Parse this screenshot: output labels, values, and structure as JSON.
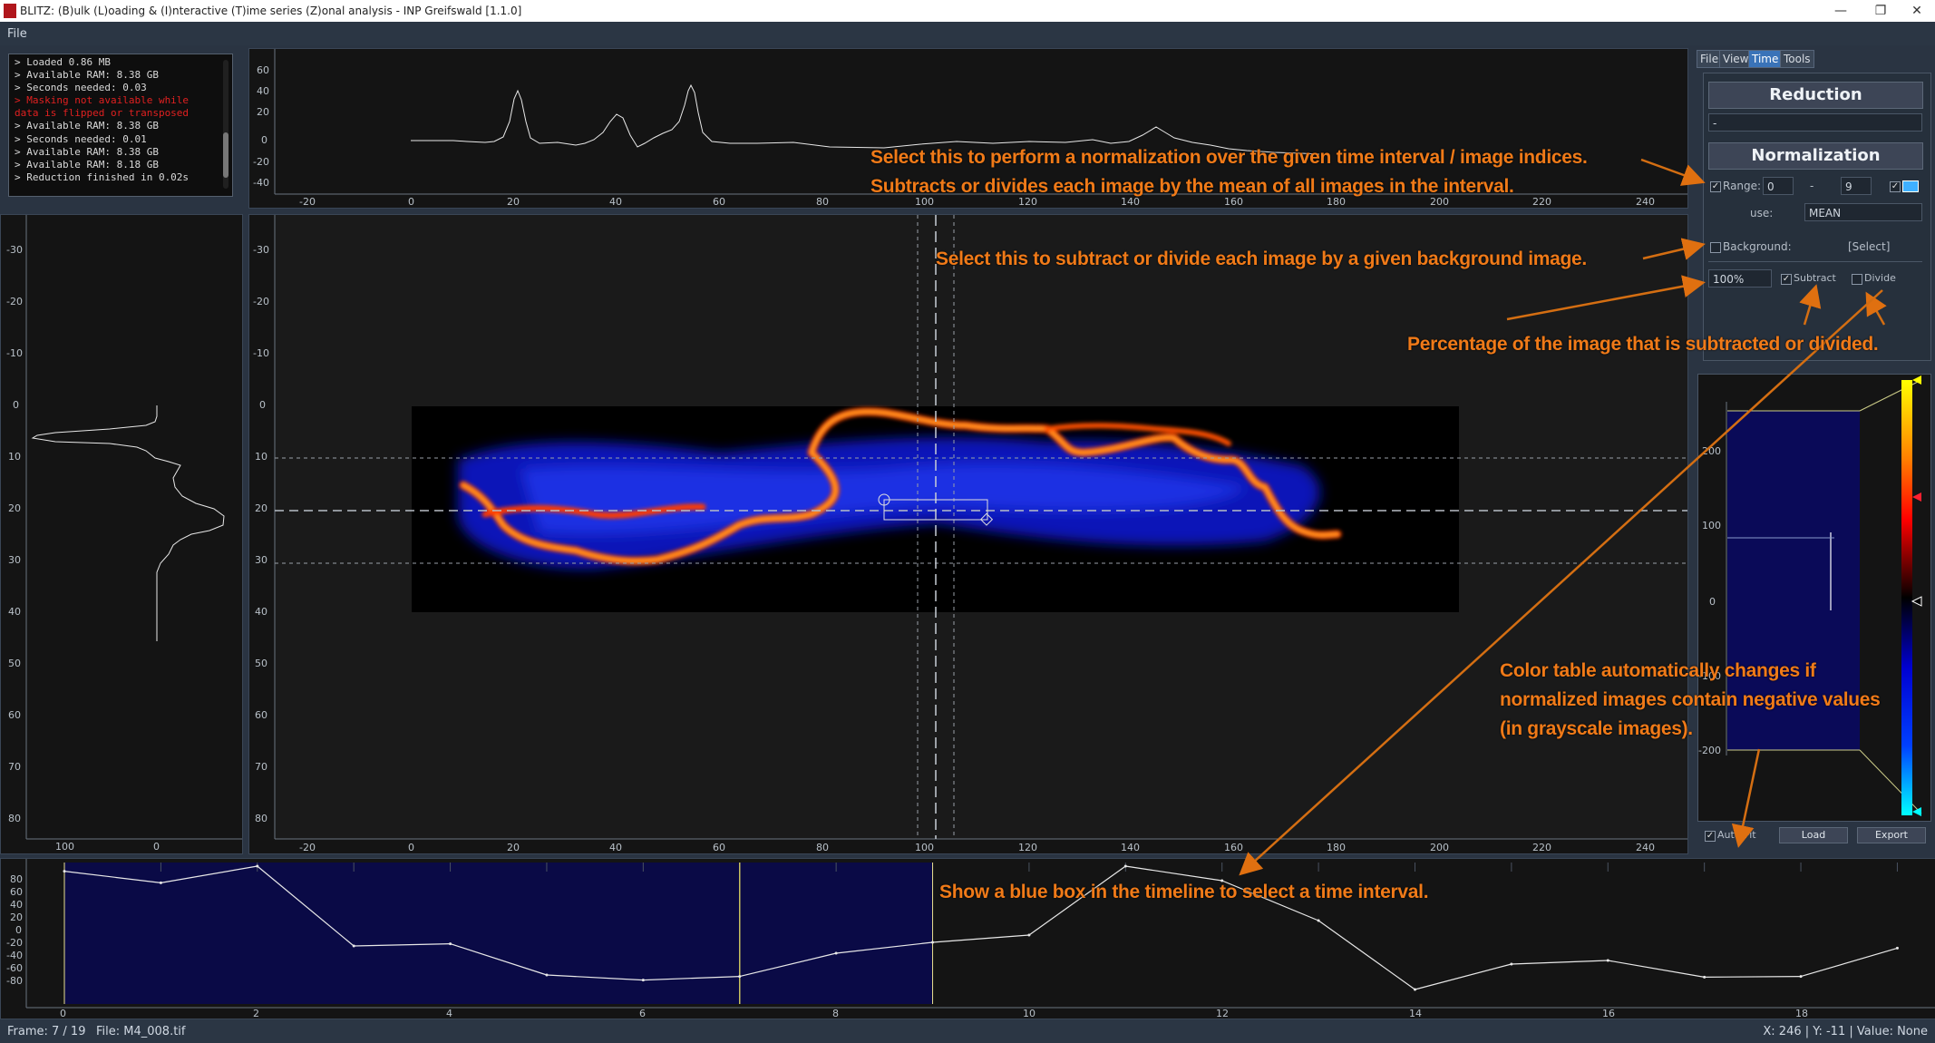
{
  "window": {
    "title": "BLITZ: (B)ulk (L)oading & (I)nteractive (T)ime series (Z)onal analysis - INP Greifswald [1.1.0]",
    "minimize_glyph": "—",
    "maximize_glyph": "❐",
    "close_glyph": "✕"
  },
  "menu": {
    "file": "File"
  },
  "console": {
    "lines": [
      {
        "text": "> Loaded 0.86 MB",
        "kind": "normal"
      },
      {
        "text": "> Available RAM: 8.38 GB",
        "kind": "normal"
      },
      {
        "text": "> Seconds needed: 0.03",
        "kind": "normal"
      },
      {
        "text": "> Masking not available while",
        "kind": "error"
      },
      {
        "text": "data is flipped or transposed",
        "kind": "error"
      },
      {
        "text": "> Available RAM: 8.38 GB",
        "kind": "normal"
      },
      {
        "text": "> Seconds needed: 0.01",
        "kind": "normal"
      },
      {
        "text": "> Available RAM: 8.38 GB",
        "kind": "normal"
      },
      {
        "text": "> Available RAM: 8.18 GB",
        "kind": "normal"
      },
      {
        "text": "> Reduction finished in 0.02s",
        "kind": "normal"
      }
    ]
  },
  "top_plot": {
    "y_ticks": [
      "60",
      "40",
      "20",
      "0",
      "-20",
      "-40"
    ],
    "x_ticks": [
      "-20",
      "0",
      "20",
      "40",
      "60",
      "80",
      "100",
      "120",
      "140",
      "160",
      "180",
      "200",
      "220",
      "240"
    ]
  },
  "left_plot": {
    "y_ticks": [
      "-30",
      "-20",
      "-10",
      "0",
      "10",
      "20",
      "30",
      "40",
      "50",
      "60",
      "70",
      "80"
    ],
    "x_ticks": [
      "100",
      "0"
    ]
  },
  "main_view": {
    "y_ticks": [
      "-30",
      "-20",
      "-10",
      "0",
      "10",
      "20",
      "30",
      "40",
      "50",
      "60",
      "70",
      "80"
    ],
    "x_ticks": [
      "-20",
      "0",
      "20",
      "40",
      "60",
      "80",
      "100",
      "120",
      "140",
      "160",
      "180",
      "200",
      "220",
      "240"
    ]
  },
  "tabs": [
    {
      "label": "File",
      "active": false
    },
    {
      "label": "View",
      "active": false
    },
    {
      "label": "Time",
      "active": true
    },
    {
      "label": "Tools",
      "active": false
    }
  ],
  "time_panel": {
    "reduction_label": "Reduction",
    "reduction_value": "-",
    "normalization_label": "Normalization",
    "range_label": "Range:",
    "range_start": "0",
    "range_sep": "-",
    "range_end": "9",
    "use_label": "use:",
    "use_value": "MEAN",
    "background_label": "Background:",
    "select_label": "[Select]",
    "percent_value": "100%",
    "subtract_label": "Subtract",
    "subtract_checked": true,
    "divide_label": "Divide",
    "divide_checked": false,
    "range_checked": true,
    "timeline_box_checked": true
  },
  "lut": {
    "y_ticks": [
      "200",
      "100",
      "0",
      "-100",
      "-200"
    ],
    "autofit_label": "Auto-Fit",
    "autofit_checked": true,
    "load_label": "Load",
    "export_label": "Export"
  },
  "timeline": {
    "y_ticks": [
      "80",
      "60",
      "40",
      "20",
      "0",
      "-20",
      "-40",
      "-60",
      "-80"
    ],
    "x_ticks": [
      "0",
      "2",
      "4",
      "6",
      "8",
      "10",
      "12",
      "14",
      "16",
      "18"
    ]
  },
  "chart_data": {
    "type": "line",
    "x": [
      0,
      1,
      2,
      3,
      4,
      5,
      6,
      7,
      8,
      9,
      10,
      11,
      12,
      13,
      14,
      15,
      16,
      17,
      18,
      19
    ],
    "values": [
      88,
      72,
      95,
      -15,
      -12,
      -55,
      -62,
      -57,
      -25,
      -10,
      0,
      95,
      75,
      20,
      -75,
      -40,
      -35,
      -58,
      -57,
      -18
    ],
    "ylim": [
      -95,
      100
    ],
    "xlim": [
      0,
      19.4
    ],
    "selected_interval": [
      0,
      9
    ],
    "current_frame": 7
  },
  "annotations": {
    "normalization": "Select this to perform a normalization over the given time interval / image indices.\nSubtracts or divides each image by the mean of all images in the interval.",
    "background": "Select this to subtract or divide each image by a given background image.",
    "percentage": "Percentage of the image that is subtracted or divided.",
    "color_table": "Color table automatically changes if\nnormalized images contain negative values\n(in grayscale images).",
    "timeline": "Show a blue box in the timeline to select a time interval."
  },
  "status": {
    "frame": "Frame: 7 / 19",
    "file": "File: M4_008.tif",
    "cursor": "X: 246 | Y: -11 | Value: None"
  },
  "colors": {
    "accent": "#f07a18",
    "tab_active": "#3a73b8",
    "selection": "#0a0a46",
    "error_text": "#e02020"
  }
}
